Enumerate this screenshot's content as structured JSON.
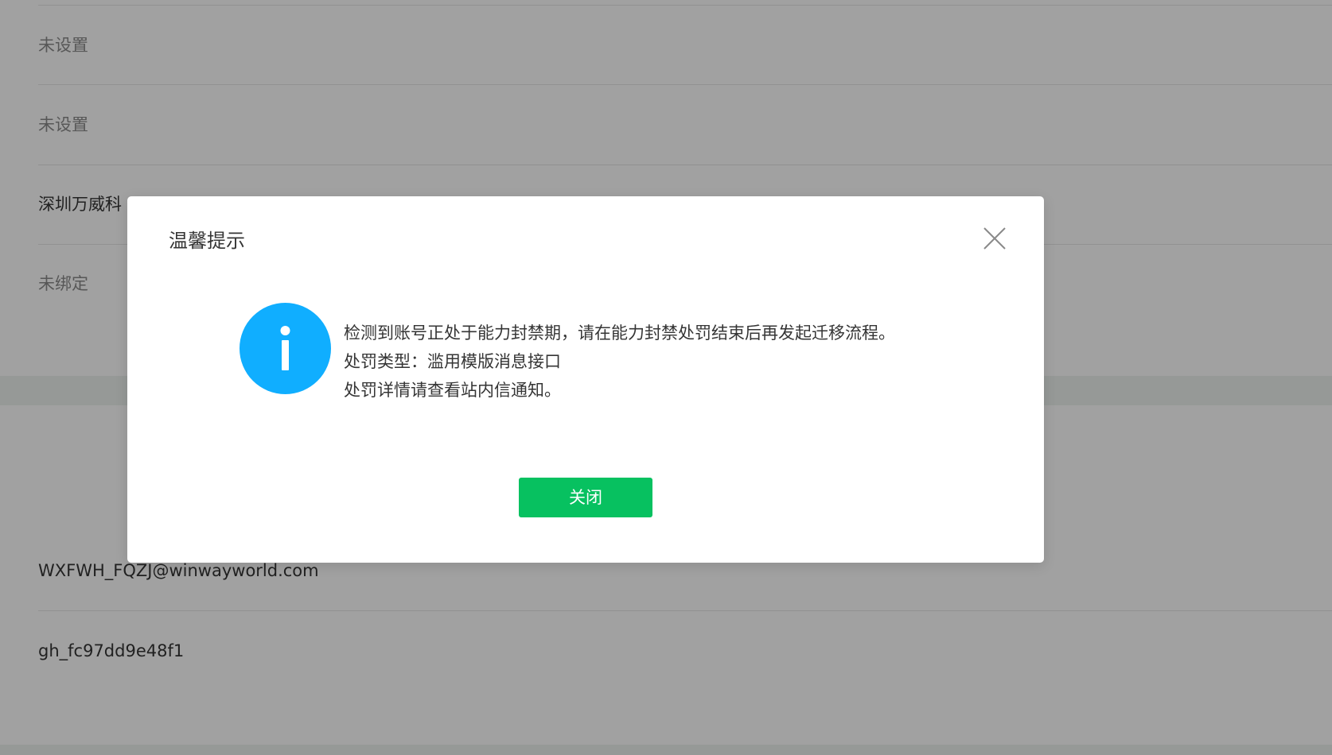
{
  "background": {
    "rows": [
      {
        "text": "未设置"
      },
      {
        "text": "未设置"
      },
      {
        "text": "深圳万威科"
      },
      {
        "text": "未绑定"
      },
      {
        "text": "WXFWH_FQZJ@winwayworld.com"
      },
      {
        "text": "gh_fc97dd9e48f1"
      }
    ]
  },
  "dialog": {
    "title": "温馨提示",
    "close_icon": "close-icon",
    "status_icon": "info-icon",
    "message_lines": [
      "检测到账号正处于能力封禁期，请在能力封禁处罚结束后再发起迁移流程。",
      "处罚类型：滥用模版消息接口",
      "处罚详情请查看站内信通知。"
    ],
    "button_label": "关闭"
  },
  "colors": {
    "accent": "#07c160",
    "info": "#10aeff",
    "overlay": "rgba(0,0,0,0.37)"
  }
}
